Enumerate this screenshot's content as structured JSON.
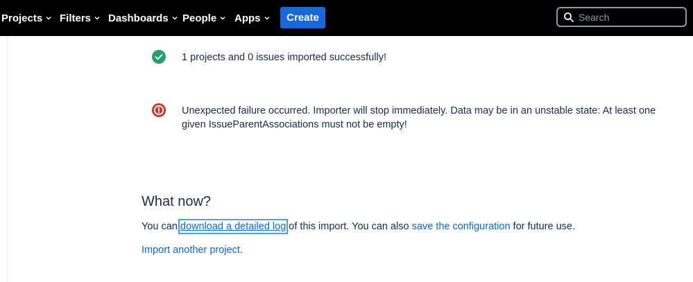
{
  "nav": {
    "items": [
      {
        "label": "Projects"
      },
      {
        "label": "Filters"
      },
      {
        "label": "Dashboards"
      },
      {
        "label": "People"
      },
      {
        "label": "Apps"
      }
    ],
    "create_label": "Create",
    "search_placeholder": "Search"
  },
  "results": {
    "success": {
      "icon": "check-circle-icon",
      "text": "1 projects and 0 issues imported successfully!",
      "color": "#22a06b"
    },
    "error": {
      "icon": "error-circle-icon",
      "line1": "Unexpected failure occurred. Importer will stop immediately. Data may be in an unstable state: At least one",
      "line2": "given IssueParentAssociations must not be empty!",
      "color": "#c9372c"
    }
  },
  "next": {
    "heading": "What now?",
    "line1_prefix": "You can ",
    "log_link": "download a detailed log",
    "line1_mid": " of this import. You can also ",
    "config_link": "save the configuration",
    "line1_suffix": " for future use.",
    "import_link": "Import another project."
  },
  "colors": {
    "brand": "#1868db",
    "link": "#0c66e4"
  }
}
